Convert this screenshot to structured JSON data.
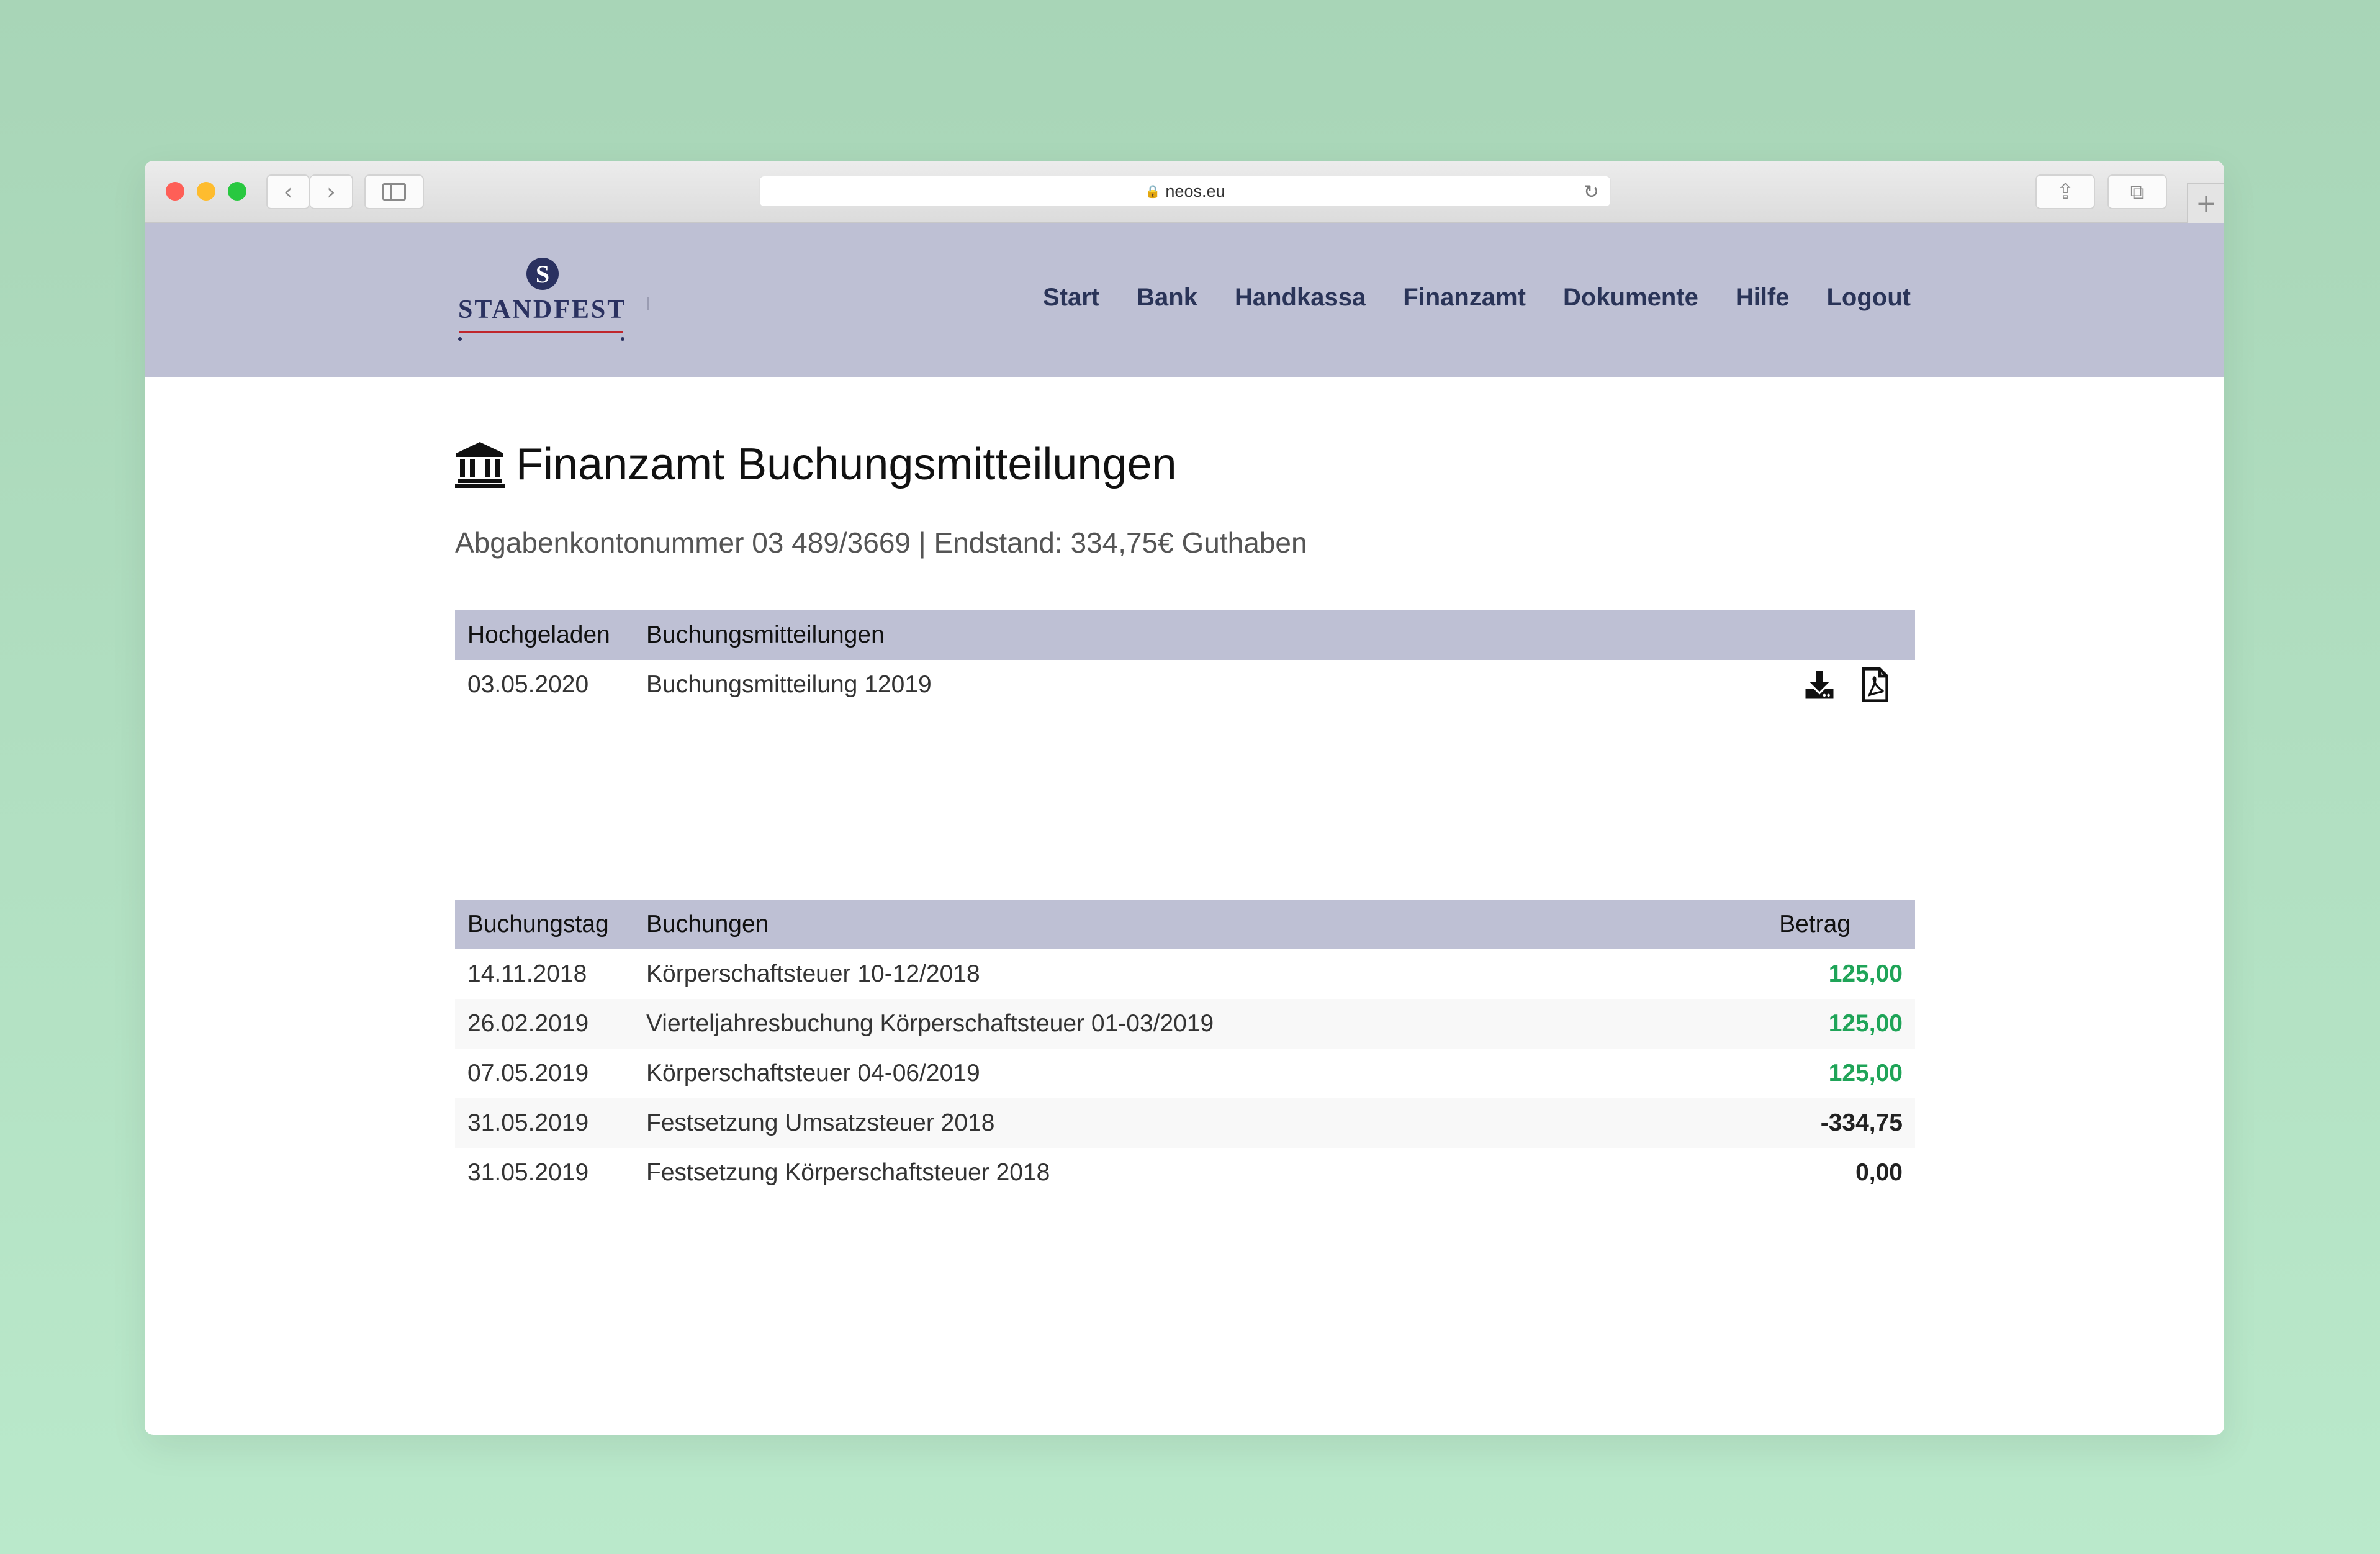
{
  "browser": {
    "url": "neos.eu"
  },
  "header": {
    "logo_text": "STANDFEST",
    "logo_mark": "S",
    "nav": [
      "Start",
      "Bank",
      "Handkassa",
      "Finanzamt",
      "Dokumente",
      "Hilfe",
      "Logout"
    ]
  },
  "page": {
    "title": "Finanzamt Buchungsmitteilungen",
    "title_icon": "bank-icon",
    "subtitle": "Abgabenkontonummer 03 489/3669 | Endstand: 334,75€ Guthaben"
  },
  "documents": {
    "headers": [
      "Hochgeladen",
      "Buchungsmitteilungen"
    ],
    "rows": [
      {
        "date": "03.05.2020",
        "name": "Buchungsmitteilung 12019"
      }
    ],
    "actions": [
      "download-icon",
      "pdf-icon"
    ]
  },
  "entries": {
    "headers": [
      "Buchungstag",
      "Buchungen",
      "Betrag"
    ],
    "rows": [
      {
        "date": "14.11.2018",
        "text": "Körperschaftsteuer 10-12/2018",
        "amount": "125,00",
        "positive": true
      },
      {
        "date": "26.02.2019",
        "text": "Vierteljahresbuchung Körperschaftsteuer 01-03/2019",
        "amount": "125,00",
        "positive": true
      },
      {
        "date": "07.05.2019",
        "text": "Körperschaftsteuer 04-06/2019",
        "amount": "125,00",
        "positive": true
      },
      {
        "date": "31.05.2019",
        "text": "Festsetzung Umsatzsteuer 2018",
        "amount": "-334,75",
        "positive": false
      },
      {
        "date": "31.05.2019",
        "text": "Festsetzung Körperschaftsteuer 2018",
        "amount": "0,00",
        "positive": false
      }
    ]
  },
  "colors": {
    "header_bg": "#bec0d4",
    "nav_text": "#2a3458",
    "positive": "#1fa458"
  }
}
